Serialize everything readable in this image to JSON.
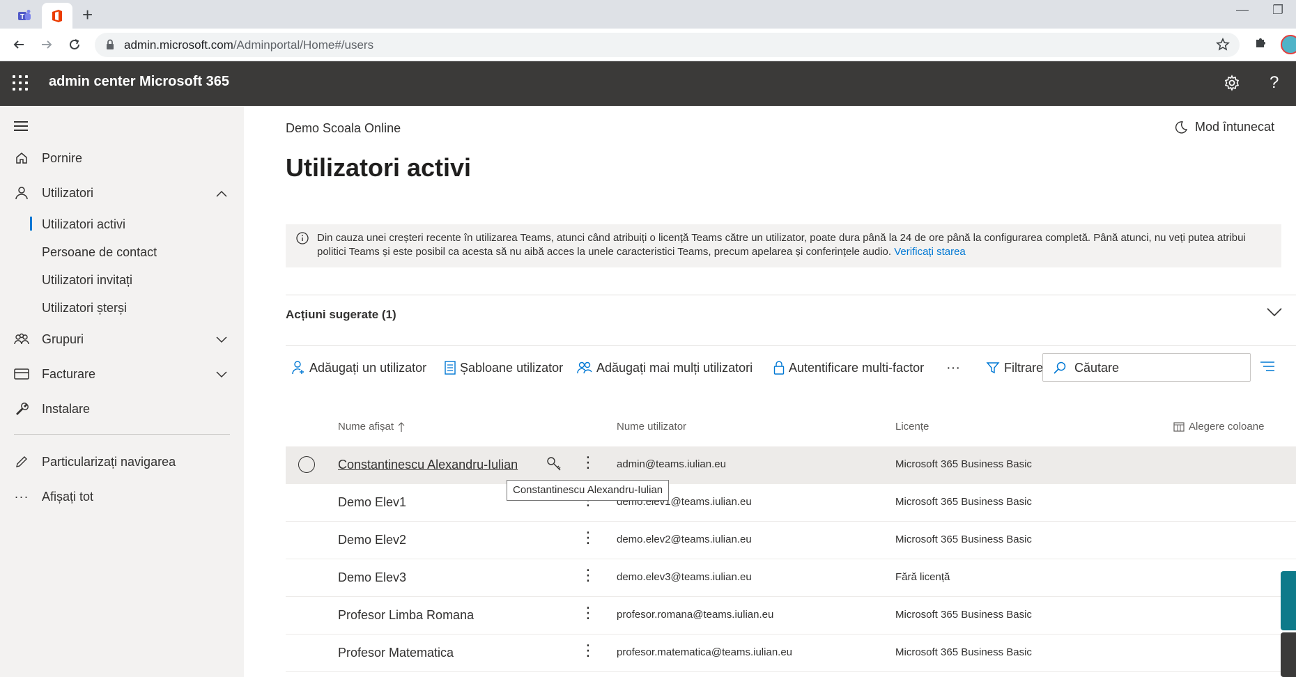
{
  "browser": {
    "url_host": "admin.microsoft.com",
    "url_path": "/Adminportal/Home#/users"
  },
  "header": {
    "app_title": "admin center Microsoft 365"
  },
  "sidebar": {
    "items": [
      {
        "label": "Pornire",
        "icon": "home-icon"
      },
      {
        "label": "Utilizatori",
        "icon": "person-icon"
      },
      {
        "label": "Grupuri",
        "icon": "group-icon"
      },
      {
        "label": "Facturare",
        "icon": "billing-icon"
      },
      {
        "label": "Instalare",
        "icon": "wrench-icon"
      },
      {
        "label": "Particularizați navigarea",
        "icon": "pencil-icon"
      },
      {
        "label": "Afișați tot",
        "icon": "ellipsis-icon"
      }
    ],
    "sub_items": [
      "Utilizatori activi",
      "Persoane de contact",
      "Utilizatori invitați",
      "Utilizatori șterși"
    ]
  },
  "main": {
    "org_name": "Demo Scoala Online",
    "dark_mode_label": "Mod întunecat",
    "page_title": "Utilizatori activi",
    "banner_text": "Din cauza unei creșteri recente în utilizarea Teams, atunci când atribuiți o licență Teams către un utilizator, poate dura până la 24 de ore până la configurarea completă. Până atunci, nu veți putea atribui politici Teams și este posibil ca acesta să nu aibă acces la unele caracteristici Teams, precum apelarea și conferințele audio.",
    "banner_link": "Verificați starea",
    "suggested_actions": "Acțiuni sugerate (1)"
  },
  "toolbar": {
    "add_user": "Adăugați un utilizator",
    "templates": "Șabloane utilizator",
    "add_multiple": "Adăugați mai mulți utilizatori",
    "mfa": "Autentificare multi-factor",
    "more": "···",
    "filter": "Filtrare",
    "search_placeholder": "Căutare"
  },
  "table": {
    "columns": {
      "display_name": "Nume afișat",
      "username": "Nume utilizator",
      "licenses": "Licențe",
      "choose_columns": "Alegere coloane"
    },
    "rows": [
      {
        "name": "Constantinescu Alexandru-Iulian",
        "user": "admin@teams.iulian.eu",
        "license": "Microsoft 365 Business Basic"
      },
      {
        "name": "Demo Elev1",
        "user": "demo.elev1@teams.iulian.eu",
        "license": "Microsoft 365 Business Basic"
      },
      {
        "name": "Demo Elev2",
        "user": "demo.elev2@teams.iulian.eu",
        "license": "Microsoft 365 Business Basic"
      },
      {
        "name": "Demo Elev3",
        "user": "demo.elev3@teams.iulian.eu",
        "license": "Fără licență"
      },
      {
        "name": "Profesor Limba Romana",
        "user": "profesor.romana@teams.iulian.eu",
        "license": "Microsoft 365 Business Basic"
      },
      {
        "name": "Profesor Matematica",
        "user": "profesor.matematica@teams.iulian.eu",
        "license": "Microsoft 365 Business Basic"
      }
    ],
    "tooltip": "Constantinescu Alexandru-Iulian"
  }
}
